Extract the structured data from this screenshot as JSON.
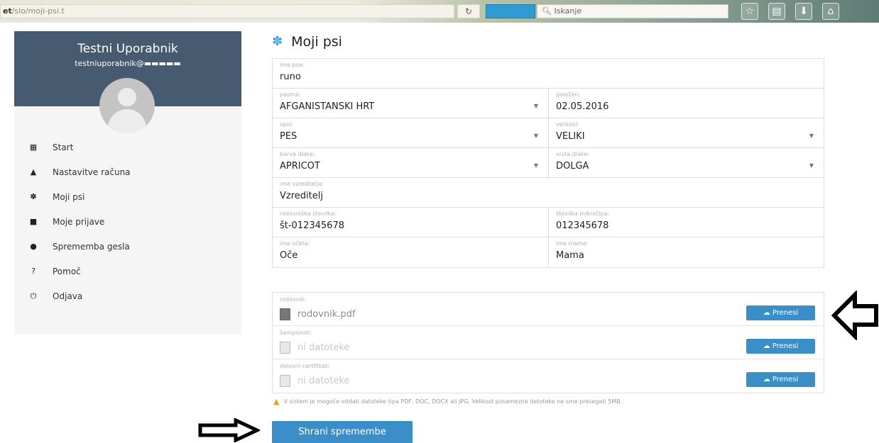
{
  "browser": {
    "url_prefix": "et",
    "url_rest": "/slo/moji-psi.t",
    "reload_icon": "refresh-icon",
    "search_placeholder": "Iskanje",
    "search_glyph": "🔍︎"
  },
  "sidebar": {
    "user_name": "Testni Uporabnik",
    "user_email": "testniuporabnik@▬▬▬▬▬",
    "items": [
      {
        "label": "Start",
        "icon": "windows-icon",
        "glyph": "▦"
      },
      {
        "label": "Nastavitve računa",
        "icon": "user-icon",
        "glyph": "▲"
      },
      {
        "label": "Moji psi",
        "icon": "paw-icon",
        "glyph": "✽"
      },
      {
        "label": "Moje prijave",
        "icon": "file-icon",
        "glyph": "■"
      },
      {
        "label": "Sprememba gesla",
        "icon": "lock-icon",
        "glyph": "●"
      },
      {
        "label": "Pomoč",
        "icon": "question-icon",
        "glyph": "?"
      },
      {
        "label": "Odjava",
        "icon": "power-icon",
        "glyph": "⏻"
      }
    ]
  },
  "page": {
    "title": "Moji psi"
  },
  "form": {
    "ime_psa": {
      "label": "ime psa:",
      "value": "runo"
    },
    "pasma": {
      "label": "pasma:",
      "value": "AFGANISTANSKI HRT"
    },
    "poleg": {
      "label": "poležen:",
      "value": "02.05.2016"
    },
    "spol": {
      "label": "spol:",
      "value": "PES"
    },
    "velikost": {
      "label": "velikost:",
      "value": "VELIKI"
    },
    "barva": {
      "label": "barva dlake:",
      "value": "APRICOT"
    },
    "vrsta": {
      "label": "vrsta dlake:",
      "value": "DOLGA"
    },
    "vzreditelj": {
      "label": "ime vzreditelja:",
      "value": "Vzreditelj"
    },
    "rodovniska": {
      "label": "rodovniška številka:",
      "value": "št-012345678"
    },
    "mikrocip": {
      "label": "številka mikročipa:",
      "value": "012345678"
    },
    "oce": {
      "label": "ime očeta:",
      "value": "Oče"
    },
    "mama": {
      "label": "ime mame:",
      "value": "Mama"
    }
  },
  "files": {
    "rows": [
      {
        "label": "rodovnik:",
        "file": "rodovnik.pdf",
        "button": "Prenesi"
      },
      {
        "label": "šampionat:",
        "file": "ni datoteke",
        "button": "Prenesi"
      },
      {
        "label": "delovni certifikat:",
        "file": "ni datoteke",
        "button": "Prenesi"
      }
    ],
    "note": "V sistem je mogoče oddati datoteke tipa PDF, DOC, DOCX ali JPG. Velikost posamezne datoteke ne sme presegati 5MB."
  },
  "actions": {
    "save": "Shrani spremembe"
  },
  "colors": {
    "sidebar_header": "#465b6f",
    "accent_blue": "#3b8fc8",
    "warning": "#f0a020"
  }
}
